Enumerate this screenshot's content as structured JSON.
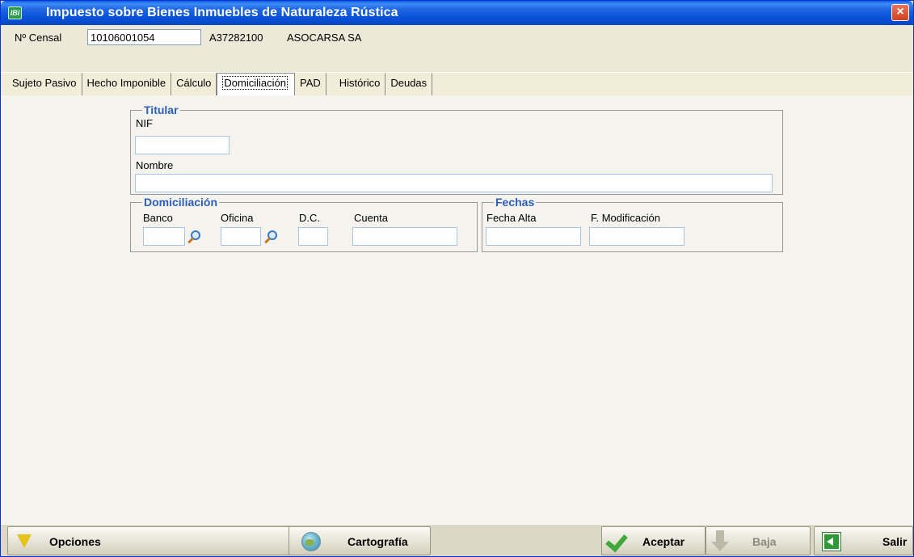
{
  "window": {
    "title": "Impuesto sobre Bienes Inmuebles de Naturaleza Rústica",
    "close_label": "×"
  },
  "census": {
    "label": "Nº Censal",
    "value": "10106001054",
    "nif": "A37282100",
    "name": "ASOCARSA SA"
  },
  "tabs": [
    {
      "label": "Sujeto Pasivo"
    },
    {
      "label": "Hecho Imponible"
    },
    {
      "label": "Cálculo"
    },
    {
      "label": "Domiciliación",
      "active": true
    },
    {
      "label": "PAD"
    },
    {
      "label": "Histórico"
    },
    {
      "label": "Deudas"
    }
  ],
  "titular": {
    "title": "Titular",
    "nif_label": "NIF",
    "nif_value": "",
    "nombre_label": "Nombre",
    "nombre_value": ""
  },
  "domiciliacion": {
    "title": "Domiciliación",
    "banco_label": "Banco",
    "banco_value": "",
    "oficina_label": "Oficina",
    "oficina_value": "",
    "dc_label": "D.C.",
    "dc_value": "",
    "cuenta_label": "Cuenta",
    "cuenta_value": ""
  },
  "fechas": {
    "title": "Fechas",
    "alta_label": "Fecha Alta",
    "alta_value": "",
    "modificacion_label": "F. Modificación",
    "modificacion_value": ""
  },
  "toolbar": {
    "opciones": "Opciones",
    "cartografia": "Cartografía",
    "aceptar": "Aceptar",
    "baja": "Baja",
    "salir": "Salir"
  }
}
